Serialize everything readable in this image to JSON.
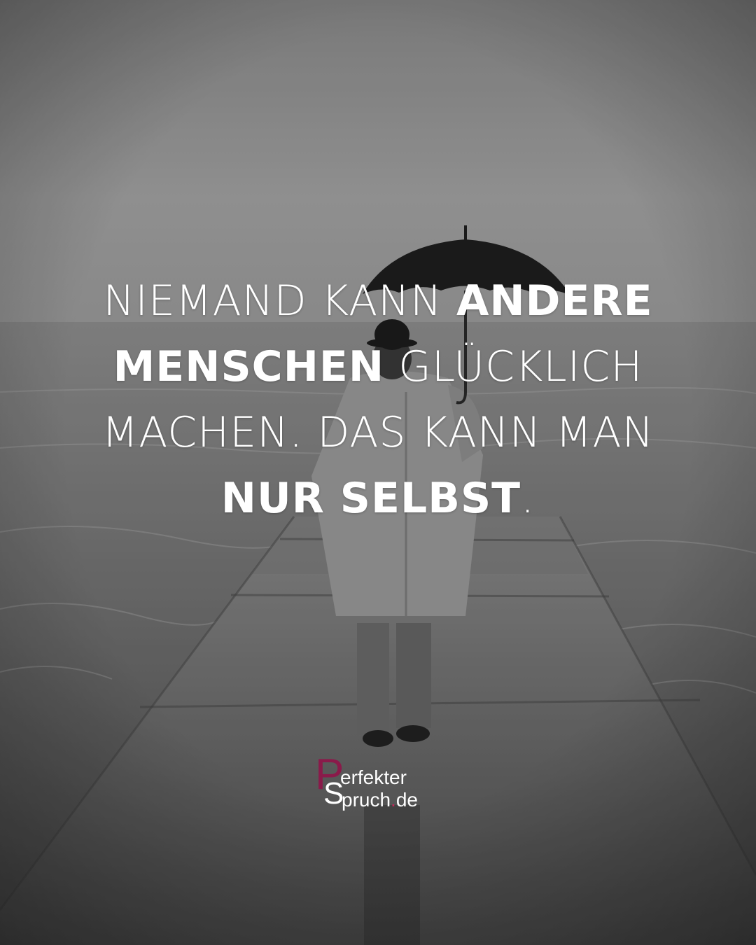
{
  "quote": {
    "line1_a": "NIEMAND KANN ",
    "line1_b": "ANDERE",
    "line2_a": "MENSCHEN",
    "line2_b": " GLÜCKLICH",
    "line3": "MACHEN. DAS KANN MAN",
    "line4_a": "NUR SELBST",
    "line4_b": "."
  },
  "logo": {
    "p": "P",
    "s": "S",
    "word1": "erfekter",
    "word2_a": "pruch",
    "word2_dot": ".",
    "word2_b": "de"
  },
  "colors": {
    "text": "#ffffff",
    "brand": "#8a1a4a",
    "dot": "#c22a5a"
  }
}
